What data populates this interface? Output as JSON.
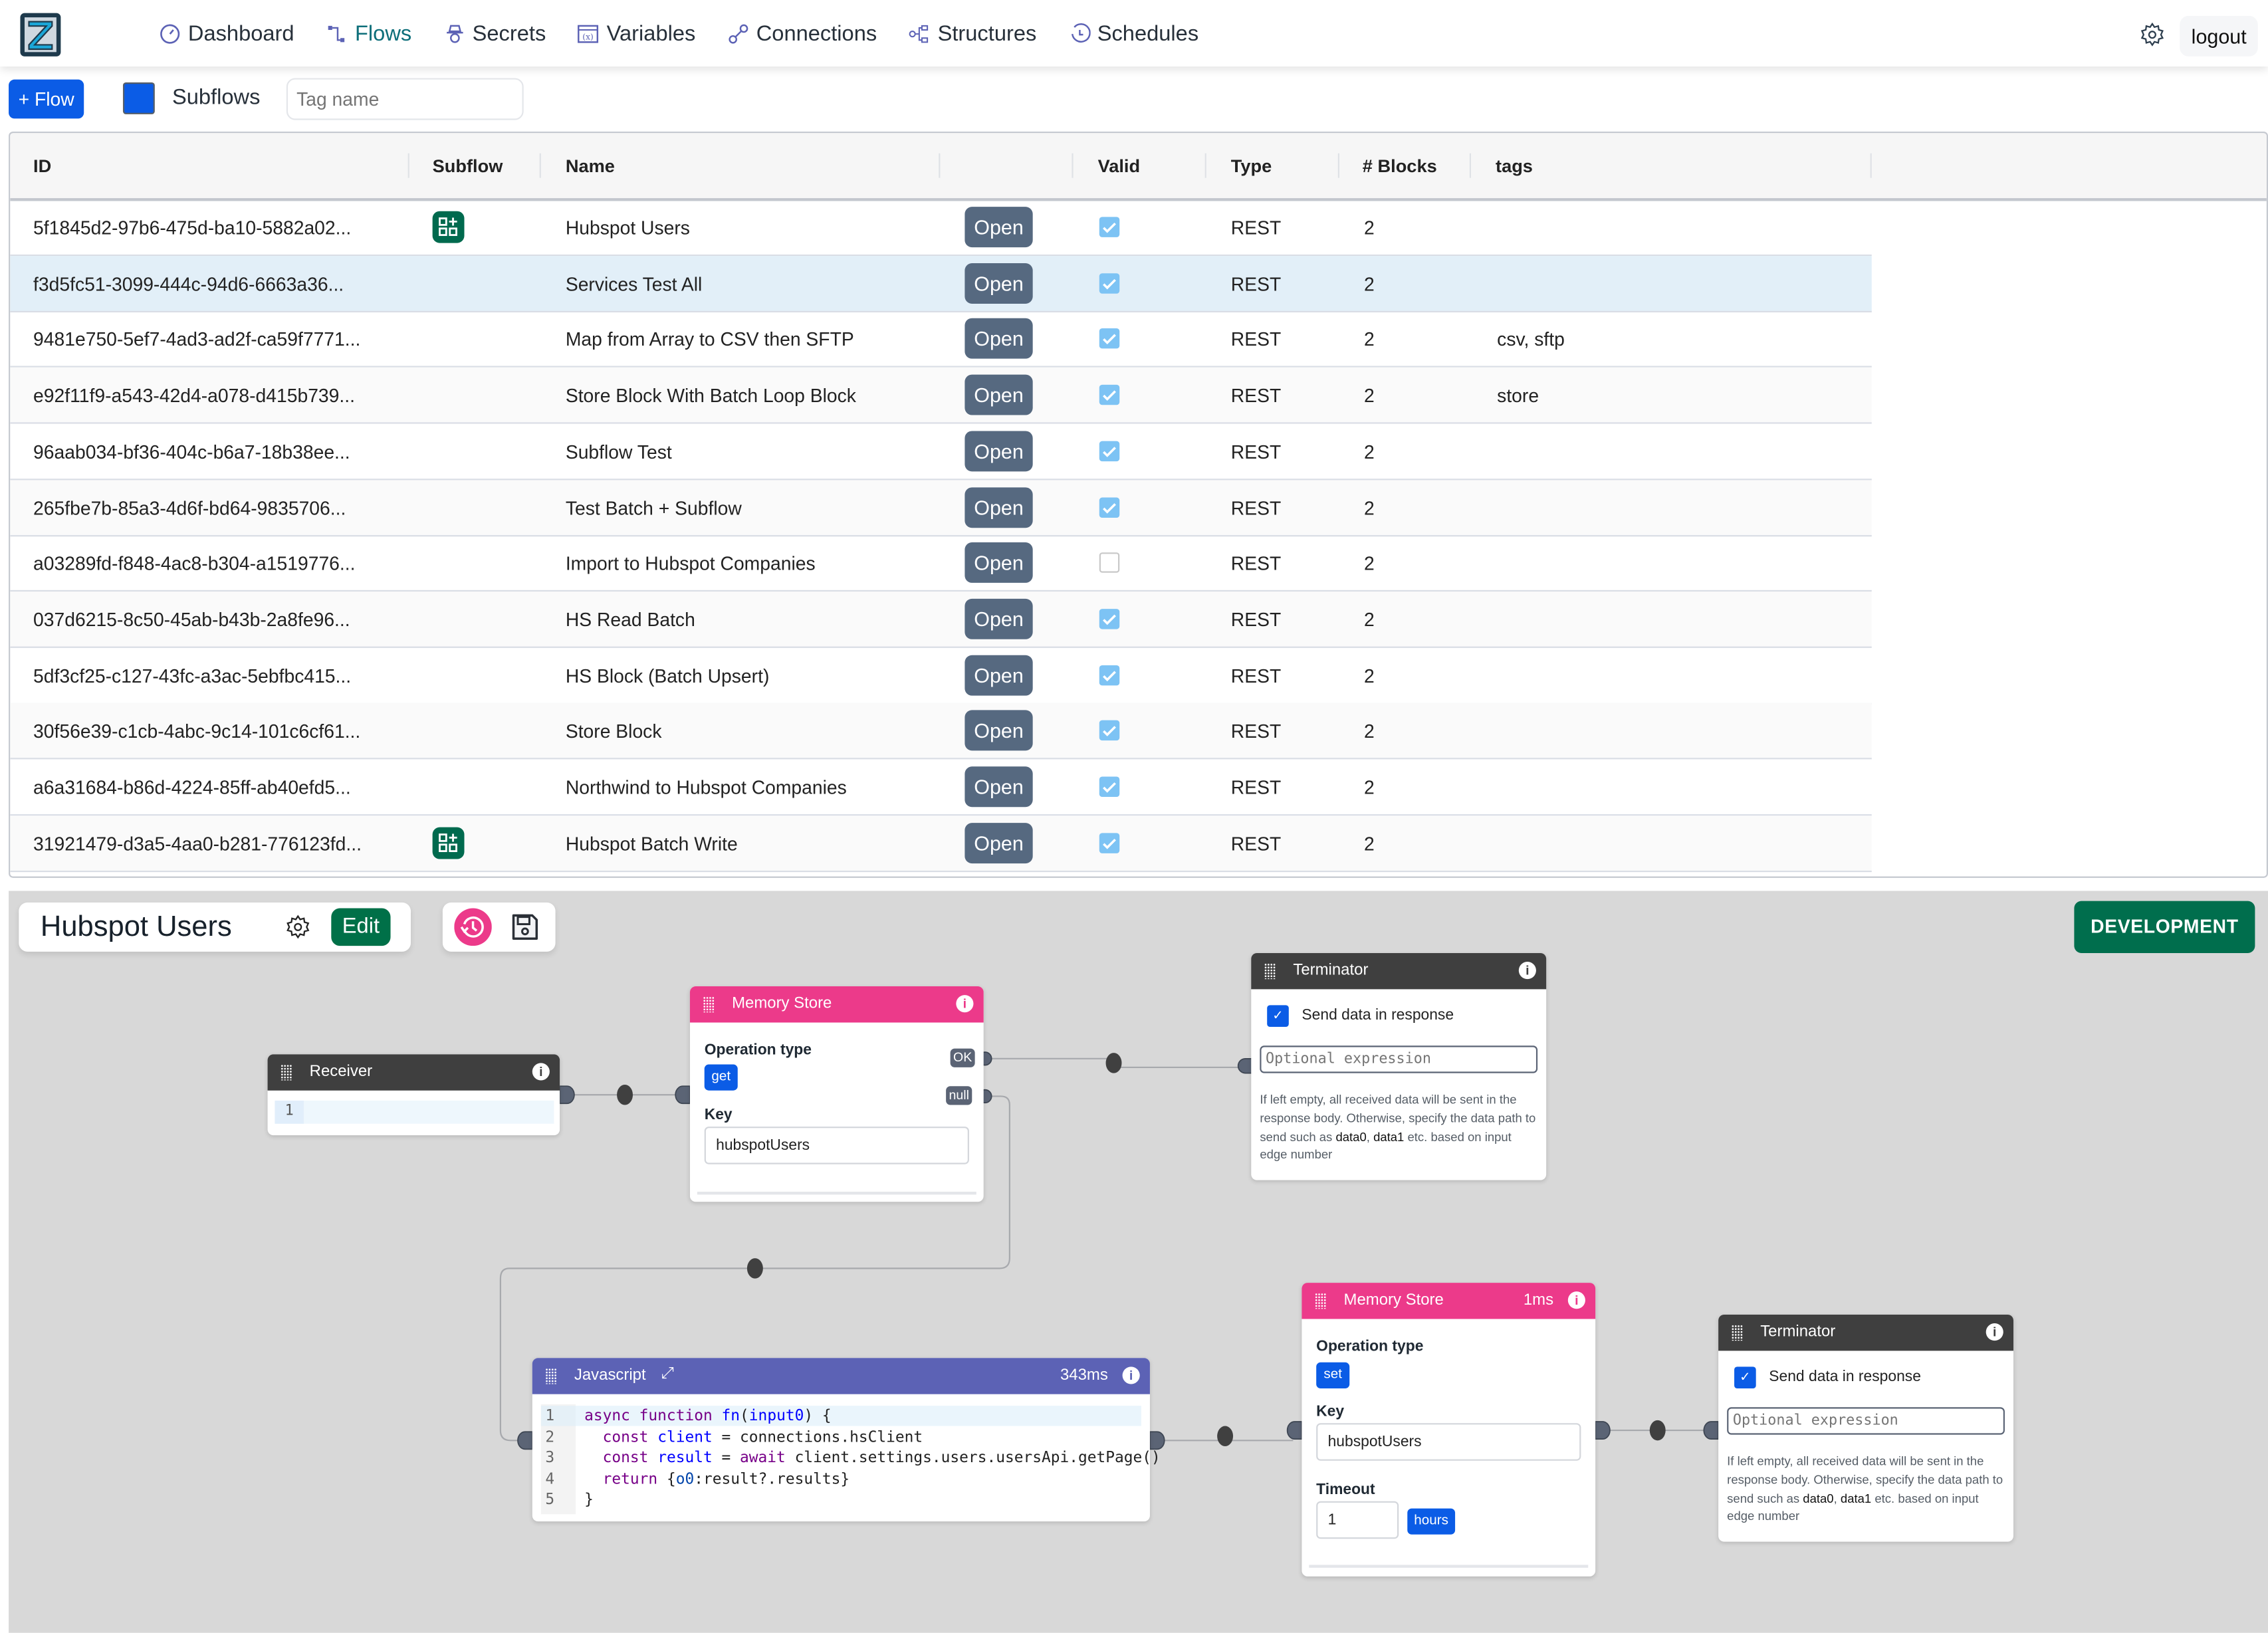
{
  "nav": {
    "logo": "app-logo",
    "items": [
      {
        "label": "Dashboard",
        "icon": "gauge-icon",
        "active": false
      },
      {
        "label": "Flows",
        "icon": "flow-icon",
        "active": true
      },
      {
        "label": "Secrets",
        "icon": "spy-icon",
        "active": false
      },
      {
        "label": "Variables",
        "icon": "variable-icon",
        "active": false
      },
      {
        "label": "Connections",
        "icon": "plug-icon",
        "active": false
      },
      {
        "label": "Structures",
        "icon": "hierarchy-icon",
        "active": false
      },
      {
        "label": "Schedules",
        "icon": "clock-icon",
        "active": false
      }
    ],
    "settings_icon": "gear-icon",
    "logout_label": "logout"
  },
  "toolbar": {
    "add_flow_label": "+ Flow",
    "subflows_label": "Subflows",
    "subflows_checked": true,
    "tag_placeholder": "Tag name",
    "tag_value": ""
  },
  "table": {
    "columns": [
      "ID",
      "Subflow",
      "Name",
      "",
      "Valid",
      "Type",
      "# Blocks",
      "tags"
    ],
    "open_label": "Open",
    "rows": [
      {
        "id": "5f1845d2-97b6-475d-ba10-5882a02...",
        "subflow": true,
        "name": "Hubspot Users",
        "valid": true,
        "type": "REST",
        "blocks": "2",
        "tags": ""
      },
      {
        "id": "f3d5fc51-3099-444c-94d6-6663a36...",
        "subflow": false,
        "name": "Services Test All",
        "valid": true,
        "type": "REST",
        "blocks": "2",
        "tags": "",
        "selected": true
      },
      {
        "id": "9481e750-5ef7-4ad3-ad2f-ca59f7771...",
        "subflow": false,
        "name": "Map from Array to CSV then SFTP",
        "valid": true,
        "type": "REST",
        "blocks": "2",
        "tags": "csv, sftp"
      },
      {
        "id": "e92f11f9-a543-42d4-a078-d415b739...",
        "subflow": false,
        "name": "Store Block With Batch Loop Block",
        "valid": true,
        "type": "REST",
        "blocks": "2",
        "tags": "store"
      },
      {
        "id": "96aab034-bf36-404c-b6a7-18b38ee...",
        "subflow": false,
        "name": "Subflow Test",
        "valid": true,
        "type": "REST",
        "blocks": "2",
        "tags": ""
      },
      {
        "id": "265fbe7b-85a3-4d6f-bd64-9835706...",
        "subflow": false,
        "name": "Test Batch + Subflow",
        "valid": true,
        "type": "REST",
        "blocks": "2",
        "tags": ""
      },
      {
        "id": "a03289fd-f848-4ac8-b304-a1519776...",
        "subflow": false,
        "name": "Import to Hubspot Companies",
        "valid": false,
        "type": "REST",
        "blocks": "2",
        "tags": ""
      },
      {
        "id": "037d6215-8c50-45ab-b43b-2a8fe96...",
        "subflow": false,
        "name": "HS Read Batch",
        "valid": true,
        "type": "REST",
        "blocks": "2",
        "tags": ""
      },
      {
        "id": "5df3cf25-c127-43fc-a3ac-5ebfbc415...",
        "subflow": false,
        "name": "HS Block (Batch Upsert)",
        "valid": true,
        "type": "REST",
        "blocks": "2",
        "tags": ""
      },
      {
        "id": "30f56e39-c1cb-4abc-9c14-101c6cf61...",
        "subflow": false,
        "name": "Store Block",
        "valid": true,
        "type": "REST",
        "blocks": "2",
        "tags": ""
      },
      {
        "id": "a6a31684-b86d-4224-85ff-ab40efd5...",
        "subflow": false,
        "name": "Northwind to Hubspot Companies",
        "valid": true,
        "type": "REST",
        "blocks": "2",
        "tags": ""
      },
      {
        "id": "31921479-d3a5-4aa0-b281-776123fd...",
        "subflow": true,
        "name": "Hubspot Batch Write",
        "valid": true,
        "type": "REST",
        "blocks": "2",
        "tags": ""
      }
    ]
  },
  "editor": {
    "flow_title": "Hubspot Users",
    "edit_label": "Edit",
    "environment_label": "DEVELOPMENT",
    "colors": {
      "accent_green": "#006e4d",
      "memory_store": "#ec3a8a",
      "javascript": "#5c62b5",
      "dark_block": "#3f3f3f",
      "primary_blue": "#0b5ce6"
    },
    "nodes": {
      "receiver": {
        "title": "Receiver",
        "line_number": "1"
      },
      "memory_store_get": {
        "title": "Memory Store",
        "operation_label": "Operation type",
        "operation": "get",
        "key_label": "Key",
        "key_value": "hubspotUsers",
        "ports": [
          "OK",
          "null"
        ]
      },
      "terminator_1": {
        "title": "Terminator",
        "checkbox_label": "Send data in response",
        "checked": true,
        "expression_placeholder": "Optional expression",
        "help_pre": "If left empty, all received data will be sent in the response body. Otherwise, specify the data path to send such as ",
        "help_data0": "data0",
        "help_sep": ", ",
        "help_data1": "data1",
        "help_post": " etc. based on input edge number"
      },
      "javascript": {
        "title": "Javascript",
        "duration": "343ms",
        "code_lines": [
          {
            "n": "1",
            "tokens": [
              [
                "kw",
                "async "
              ],
              [
                "kw",
                "function "
              ],
              [
                "def",
                "fn"
              ],
              [
                "",
                "("
              ],
              [
                "def",
                "input0"
              ],
              [
                "",
                ") {"
              ]
            ]
          },
          {
            "n": "2",
            "tokens": [
              [
                "",
                "  "
              ],
              [
                "kw",
                "const "
              ],
              [
                "def",
                "client"
              ],
              [
                "",
                " = connections.hsClient"
              ]
            ]
          },
          {
            "n": "3",
            "tokens": [
              [
                "",
                "  "
              ],
              [
                "kw",
                "const "
              ],
              [
                "def",
                "result"
              ],
              [
                "",
                " = "
              ],
              [
                "kw",
                "await"
              ],
              [
                "",
                " client.settings.users.usersApi.getPage()"
              ]
            ]
          },
          {
            "n": "4",
            "tokens": [
              [
                "",
                "  "
              ],
              [
                "kw",
                "return "
              ],
              [
                "",
                "{"
              ],
              [
                "var",
                "o0"
              ],
              [
                "",
                ":result?.results}"
              ]
            ]
          },
          {
            "n": "5",
            "tokens": [
              [
                "",
                "}"
              ]
            ]
          }
        ]
      },
      "memory_store_set": {
        "title": "Memory Store",
        "duration": "1ms",
        "operation_label": "Operation type",
        "operation": "set",
        "key_label": "Key",
        "key_value": "hubspotUsers",
        "timeout_label": "Timeout",
        "timeout_value": "1",
        "timeout_unit": "hours"
      },
      "terminator_2": {
        "title": "Terminator",
        "checkbox_label": "Send data in response",
        "checked": true,
        "expression_placeholder": "Optional expression",
        "help_pre": "If left empty, all received data will be sent in the response body. Otherwise, specify the data path to send such as ",
        "help_data0": "data0",
        "help_sep": ", ",
        "help_data1": "data1",
        "help_post": " etc. based on input edge number"
      }
    }
  }
}
